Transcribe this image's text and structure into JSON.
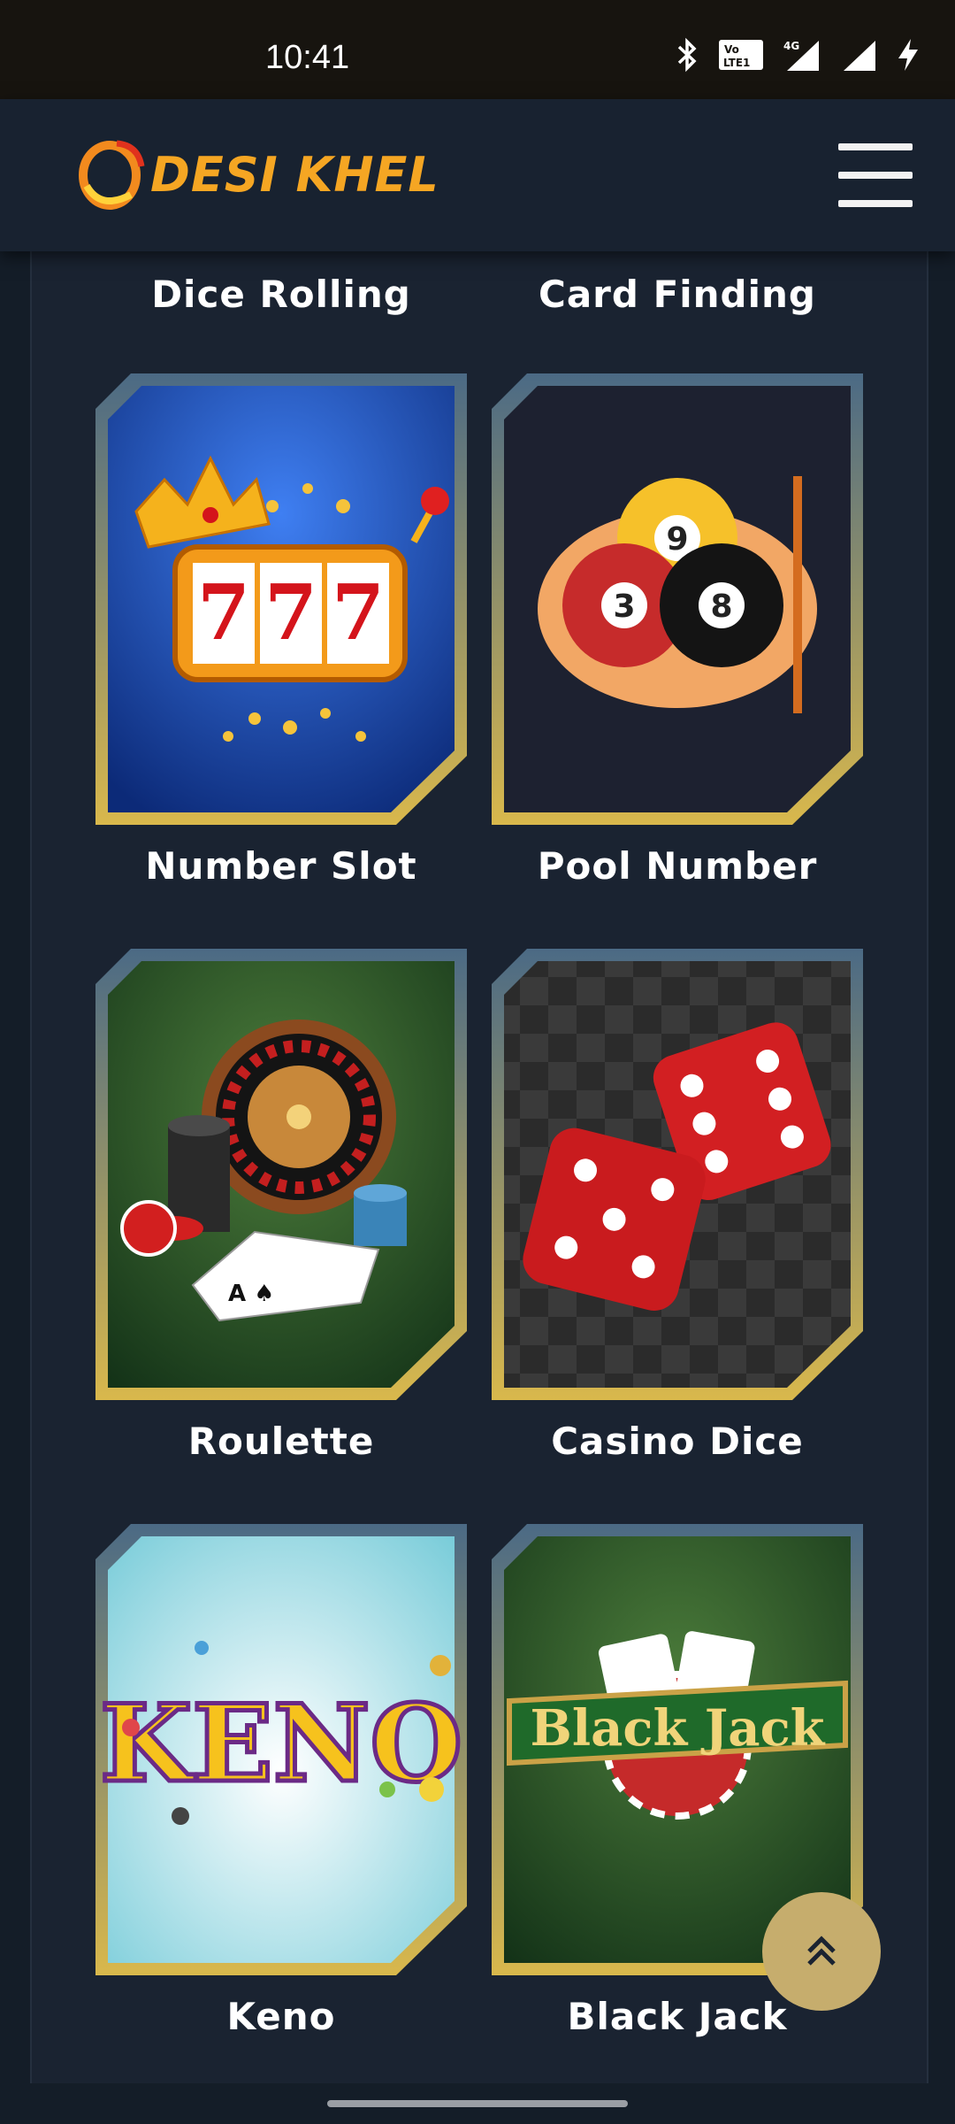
{
  "status_bar": {
    "time": "10:41",
    "icons": [
      "bluetooth-icon",
      "volte-icon",
      "4g-signal-icon",
      "signal-icon",
      "charging-icon"
    ]
  },
  "header": {
    "logo_text": "DESI KHEL",
    "menu_icon": "hamburger-menu-icon"
  },
  "games": {
    "top_labels": [
      "Dice Rolling",
      "Card Finding"
    ],
    "items": [
      {
        "label": "Number Slot",
        "image": "slot-machine-777"
      },
      {
        "label": "Pool Number",
        "image": "pool-balls"
      },
      {
        "label": "Roulette",
        "image": "roulette-wheel"
      },
      {
        "label": "Casino Dice",
        "image": "red-dice"
      },
      {
        "label": "Keno",
        "image": "keno-logo",
        "image_text": "KENO"
      },
      {
        "label": "Black Jack",
        "image": "blackjack-logo",
        "image_text": "Black Jack"
      }
    ]
  },
  "colors": {
    "accent_gold": "#c9a94a",
    "frame_blue": "#4b6a85",
    "background": "#141d28"
  },
  "scroll_top_icon": "chevron-double-up-icon"
}
